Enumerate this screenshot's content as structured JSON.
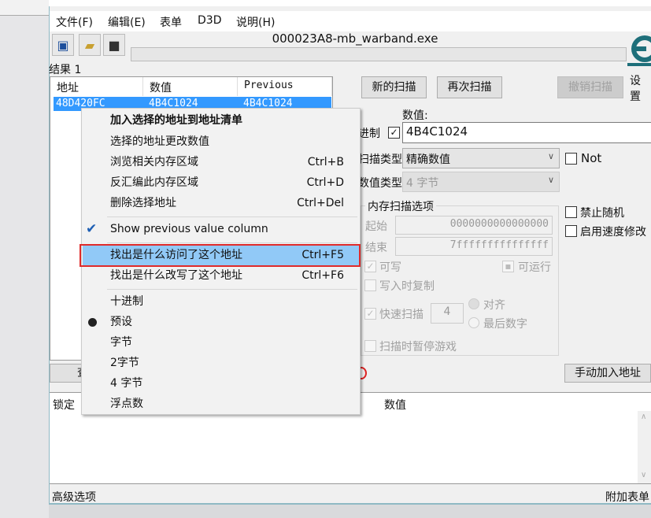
{
  "menubar": [
    "文件(F)",
    "编辑(E)",
    "表单",
    "D3D",
    "说明(H)"
  ],
  "toolbar": {
    "icons": [
      "open-process-icon",
      "open-file-icon",
      "save-icon"
    ]
  },
  "process_title": "000023A8-mb_warband.exe",
  "settings_label": "设置",
  "results": {
    "label": "结果 1",
    "columns": [
      "地址",
      "数值",
      "Previous"
    ],
    "rows": [
      {
        "address": "48D420FC",
        "value": "4B4C1024",
        "previous": "4B4C1024"
      }
    ]
  },
  "buttons": {
    "new_scan": "新的扫描",
    "next_scan": "再次扫描",
    "undo_scan": "撤销扫描",
    "add_address": "手动加入地址",
    "view_memory": "查"
  },
  "scan": {
    "value_label": "数值:",
    "hex_label": "进制",
    "hex_checked": true,
    "value": "4B4C1024",
    "scan_type_label": "扫描类型",
    "scan_type": "精确数值",
    "not_label": "Not",
    "value_type_label": "数值类型",
    "value_type": "4 字节"
  },
  "mem_options": {
    "title": "内存扫描选项",
    "start_label": "起始",
    "start": "0000000000000000",
    "stop_label": "结束",
    "stop": "7fffffffffffffff",
    "writable": "可写",
    "executable": "可运行",
    "copy_on_write": "写入时复制",
    "fast_scan": "快速扫描",
    "fast_scan_value": "4",
    "aligned": "对齐",
    "last_digits": "最后数字",
    "pause_game": "扫描时暂停游戏"
  },
  "right_options": {
    "no_random": "禁止随机",
    "speedhack": "启用速度修改"
  },
  "address_list": {
    "columns": [
      "锁定",
      "数值"
    ]
  },
  "statusbar": {
    "advanced": "高级选项",
    "table_extras": "附加表单"
  },
  "context_menu": [
    {
      "label": "加入选择的地址到地址清单",
      "shortcut": ""
    },
    {
      "label": "选择的地址更改数值",
      "shortcut": ""
    },
    {
      "label": "浏览相关内存区域",
      "shortcut": "Ctrl+B"
    },
    {
      "label": "反汇编此内存区域",
      "shortcut": "Ctrl+D"
    },
    {
      "label": "删除选择地址",
      "shortcut": "Ctrl+Del"
    },
    {
      "label": "Show previous value column",
      "shortcut": "",
      "checked": true
    },
    {
      "label": "找出是什么访问了这个地址",
      "shortcut": "Ctrl+F5",
      "highlighted": true
    },
    {
      "label": "找出是什么改写了这个地址",
      "shortcut": "Ctrl+F6"
    },
    {
      "label": "十进制",
      "shortcut": ""
    },
    {
      "label": "预设",
      "shortcut": "",
      "selected": true
    },
    {
      "label": "字节",
      "shortcut": ""
    },
    {
      "label": "2字节",
      "shortcut": ""
    },
    {
      "label": "4 字节",
      "shortcut": ""
    },
    {
      "label": "浮点数",
      "shortcut": ""
    }
  ]
}
